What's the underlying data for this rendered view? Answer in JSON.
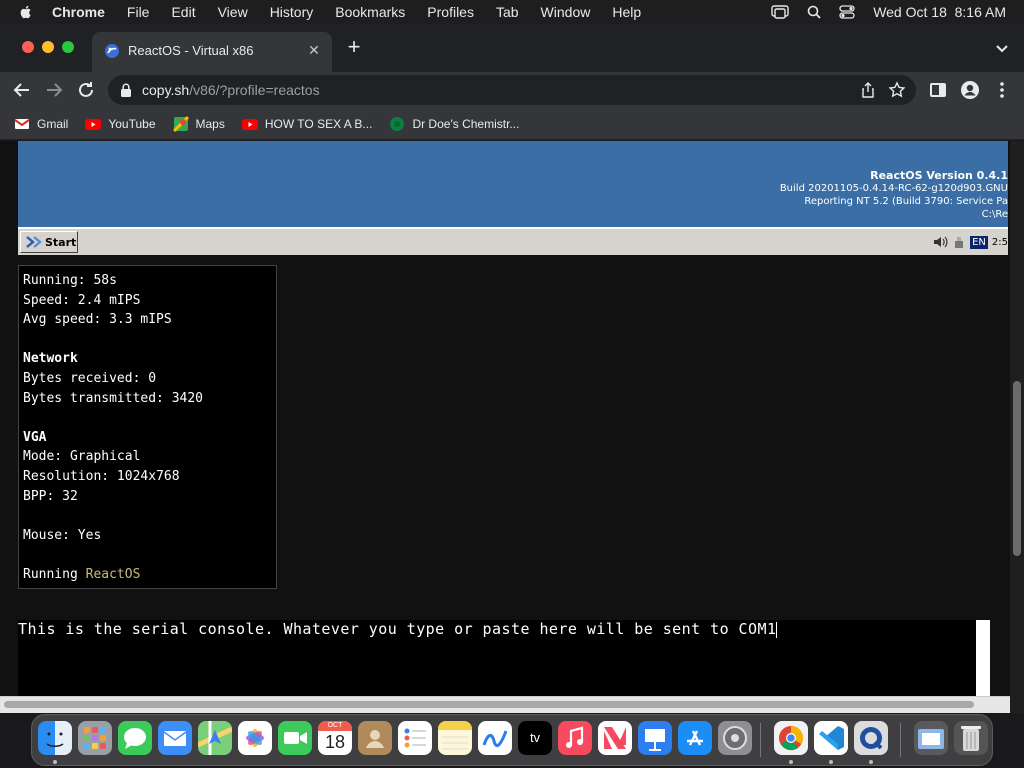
{
  "menubar": {
    "app": "Chrome",
    "items": [
      "File",
      "Edit",
      "View",
      "History",
      "Bookmarks",
      "Profiles",
      "Tab",
      "Window",
      "Help"
    ],
    "clock": "Wed Oct 18  8:16 AM"
  },
  "tab": {
    "title": "ReactOS - Virtual x86",
    "close": "✕",
    "new": "+"
  },
  "omnibox": {
    "host": "copy.sh",
    "path": "/v86/?profile=reactos"
  },
  "bookmarks": [
    {
      "label": "Gmail",
      "color": "#d93025"
    },
    {
      "label": "YouTube",
      "color": "#ff0000"
    },
    {
      "label": "Maps",
      "color": "#34a853"
    },
    {
      "label": "HOW TO SEX A B...",
      "color": "#ff0000"
    },
    {
      "label": "Dr Doe's Chemistr...",
      "color": "#0b8043"
    }
  ],
  "reactos": {
    "version": "ReactOS Version 0.4.1",
    "build": "Build 20201105-0.4.14-RC-62-g120d903.GNU",
    "reporting": "Reporting NT 5.2 (Build 3790: Service Pa",
    "path": "C:\\Re",
    "start": "Start",
    "lang": "EN",
    "time": "2:5"
  },
  "stats": {
    "running": "Running: 58s",
    "speed": "Speed: 2.4 mIPS",
    "avg_speed": "Avg speed: 3.3 mIPS",
    "network_header": "Network",
    "bytes_received": "Bytes received: 0",
    "bytes_transmitted": "Bytes transmitted: 3420",
    "vga_header": "VGA",
    "mode": "Mode: Graphical",
    "resolution": "Resolution: 1024x768",
    "bpp": "BPP: 32",
    "mouse": "Mouse: Yes",
    "running_prefix": "Running ",
    "os": "ReactOS"
  },
  "serial": {
    "text": "This is the serial console. Whatever you type or paste here will be sent to COM1"
  },
  "dock": {
    "calendar_month": "OCT",
    "calendar_day": "18",
    "tv_label": "tv"
  },
  "colors": {
    "page_bg": "#111111",
    "reactos_desktop": "#3a6ea5",
    "os_text": "#c8b97a"
  }
}
